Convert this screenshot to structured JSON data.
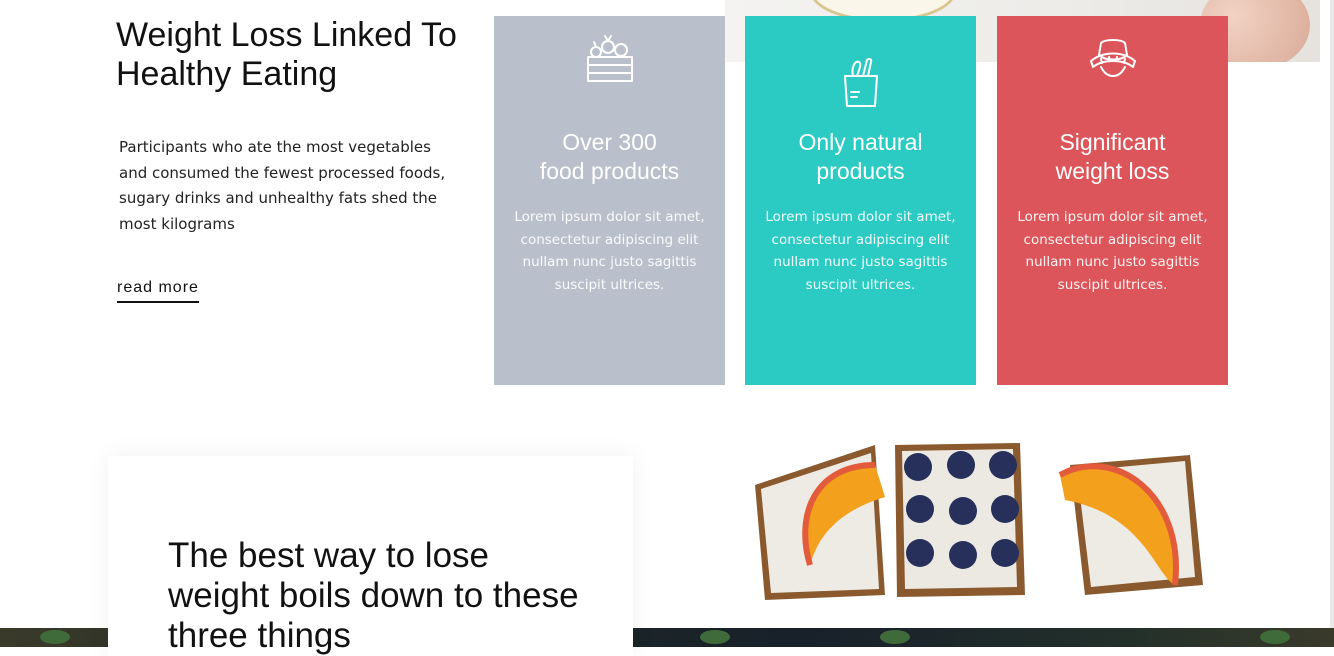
{
  "intro": {
    "title": "Weight Loss Linked To Healthy Eating",
    "text": "Participants who ate the most vegetables and consumed the fewest processed foods, sugary drinks and unhealthy fats shed the most kilograms",
    "read_more": "read more"
  },
  "cards": [
    {
      "icon": "vegetable-crate-icon",
      "title": "Over 300\nfood products",
      "text": "Lorem ipsum dolor sit amet, consectetur adipiscing elit nullam nunc justo sagittis suscipit ultrices.",
      "color": "#b9c0cb"
    },
    {
      "icon": "grocery-bag-icon",
      "title": "Only natural\nproducts",
      "text": "Lorem ipsum dolor sit amet, consectetur adipiscing elit nullam nunc justo sagittis suscipit ultrices.",
      "color": "#2bcbc3"
    },
    {
      "icon": "measuring-tape-icon",
      "title": "Significant\nweight loss",
      "text": "Lorem ipsum dolor sit amet, consectetur adipiscing elit nullam nunc justo sagittis suscipit ultrices.",
      "color": "#dc555a"
    }
  ],
  "info": {
    "title": "The best way to lose weight boils down to these three things"
  }
}
